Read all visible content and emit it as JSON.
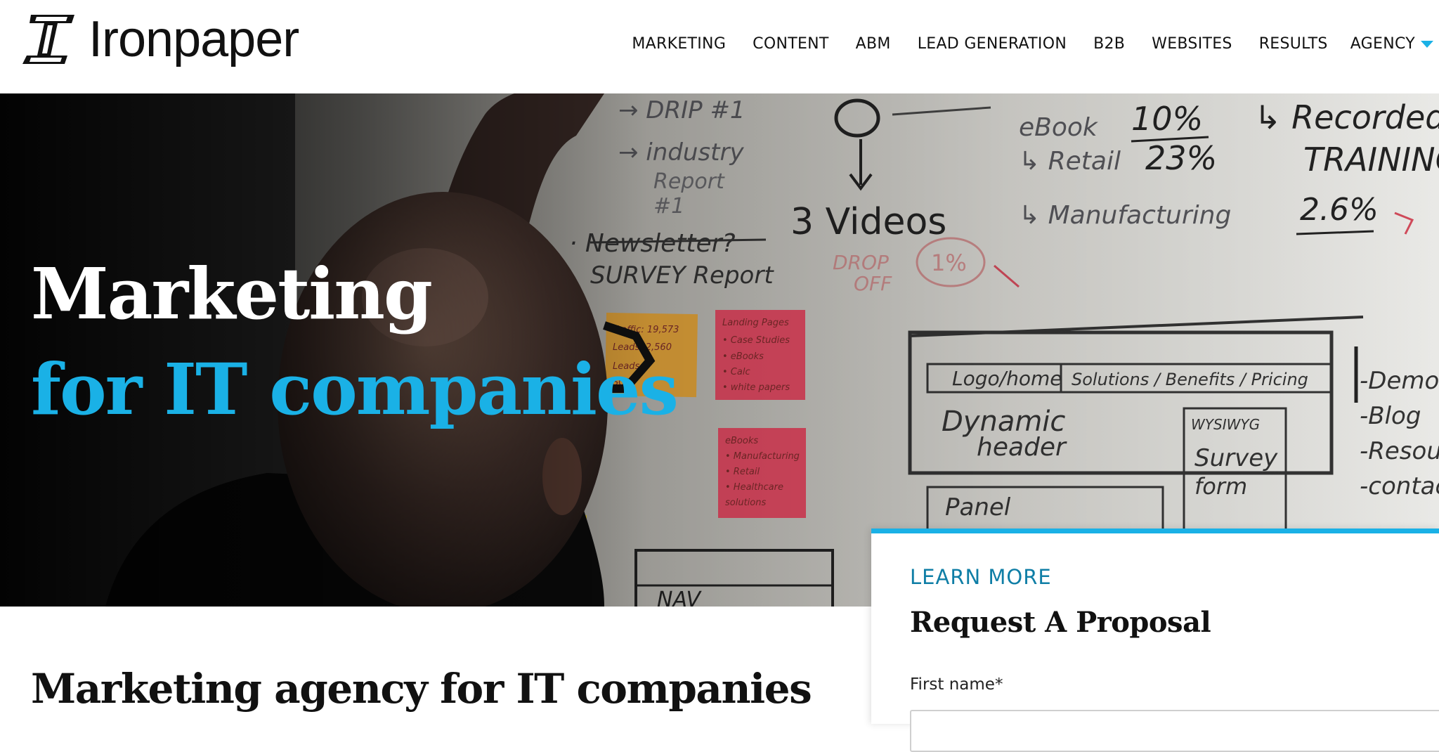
{
  "brand": {
    "name": "Ironpaper",
    "accent_color": "#1ab1e6"
  },
  "nav": {
    "items": [
      {
        "label": "MARKETING"
      },
      {
        "label": "CONTENT"
      },
      {
        "label": "ABM"
      },
      {
        "label": "LEAD GENERATION"
      },
      {
        "label": "B2B"
      },
      {
        "label": "WEBSITES"
      },
      {
        "label": "RESULTS"
      }
    ],
    "agency": {
      "label": "AGENCY",
      "icon": "chevron-down-icon"
    }
  },
  "hero": {
    "title_line1": "Marketing",
    "title_line2": "for IT companies",
    "whiteboard": {
      "items": [
        "→ DRIP #1",
        "→ industry Report #1",
        "· Newsletter?",
        "SURVEY Report",
        "3 Videos",
        "DROP OFF",
        "1%",
        "eBook",
        "↳ Retail",
        "↳ Manufacturing",
        "10%",
        "23%",
        "↳ Recorded",
        "TRAINING",
        "2.6%"
      ],
      "wireframe": {
        "nav": [
          "Logo/home",
          "Solutions / Benefits / Pricing"
        ],
        "header": "Dynamic header",
        "form_tag": "WYSIWYG",
        "form": "Survey form",
        "panel": "Panel",
        "list": [
          "-Demo",
          "-Blog",
          "-Resources",
          "-Contact"
        ],
        "footer": "NAV"
      },
      "notes": {
        "orange": [
          "Traffic: 19,573",
          "Leads: 2,560",
          "Leads",
          "SQL"
        ],
        "red1": [
          "Landing Pages",
          "• Case Studies",
          "• eBooks",
          "• Calc",
          "• white papers"
        ],
        "red2": [
          "eBooks",
          "• Manufacturing",
          "• Retail",
          "• Healthcare",
          "solutions"
        ]
      }
    }
  },
  "main": {
    "heading": "Marketing agency for IT companies"
  },
  "proposal": {
    "eyebrow": "LEARN MORE",
    "title": "Request A Proposal",
    "first_name_label": "First name*",
    "first_name_value": ""
  }
}
